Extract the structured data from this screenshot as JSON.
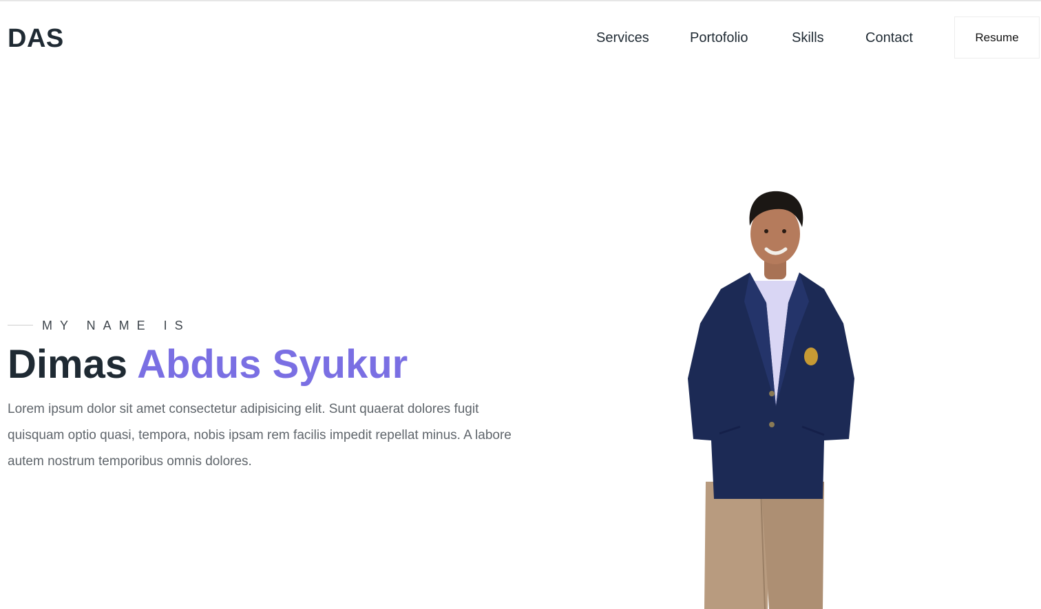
{
  "header": {
    "logo": "DAS",
    "nav": [
      {
        "label": "Services"
      },
      {
        "label": "Portofolio"
      },
      {
        "label": "Skills"
      },
      {
        "label": "Contact"
      }
    ],
    "resume_label": "Resume"
  },
  "hero": {
    "eyebrow": "MY NAME IS",
    "first_name": "Dimas",
    "accent_name": "Abdus Syukur",
    "description": "Lorem ipsum dolor sit amet consectetur adipisicing elit. Sunt quaerat dolores fugit quisquam optio quasi, tempora, nobis ipsam rem facilis impedit repellat minus. A labore autem nostrum temporibus omnis dolores."
  },
  "colors": {
    "text_dark": "#1f2a33",
    "accent": "#7a6fe3",
    "body_text": "#5f656b",
    "jacket": "#1c2a55",
    "trousers": "#b89b7f"
  }
}
